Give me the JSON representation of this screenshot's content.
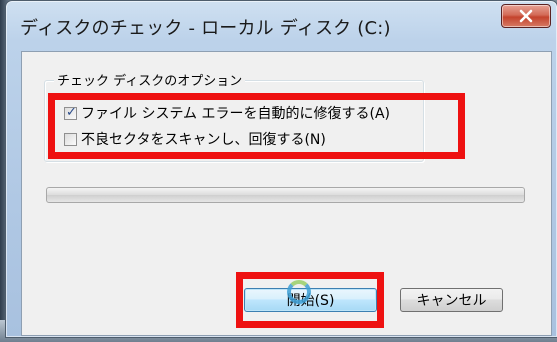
{
  "window": {
    "title": "ディスクのチェック - ローカル ディスク (C:)",
    "close_glyph": "X"
  },
  "options": {
    "group_label": "チェック ディスクのオプション",
    "items": [
      {
        "label": "ファイル システム エラーを自動的に修復する(A)",
        "checked": true
      },
      {
        "label": "不良セクタをスキャンし、回復する(N)",
        "checked": false
      }
    ]
  },
  "progress": {
    "value": 0
  },
  "buttons": {
    "start_label": "開始(S)",
    "cancel_label": "キャンセル"
  },
  "colors": {
    "highlight": "#ee1111",
    "close_button": "#c4432d"
  }
}
